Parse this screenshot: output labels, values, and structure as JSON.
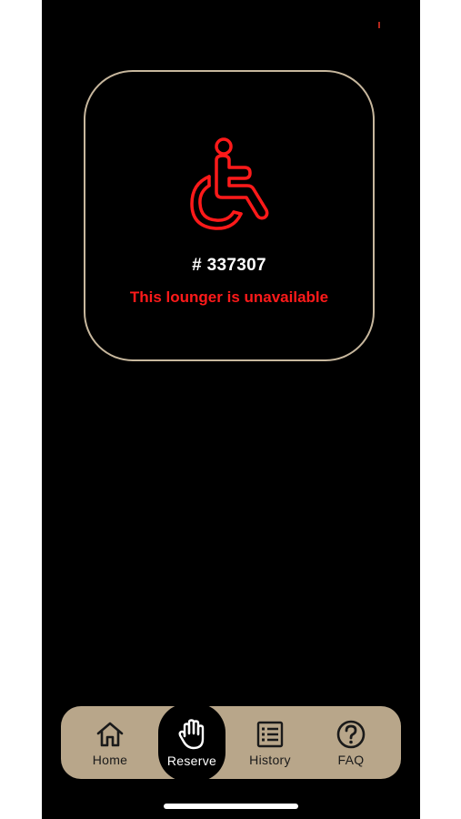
{
  "lounger": {
    "icon": "wheelchair-icon",
    "id_text": "# 337307",
    "status_text": "This lounger is unavailable",
    "status_color": "#ff1a1a"
  },
  "colors": {
    "background": "#000000",
    "card_border": "#c7b79d",
    "tabbar": "#b8a68a",
    "active_tab": "#000000"
  },
  "tabbar": {
    "active": "Reserve",
    "items": [
      {
        "label": "Home",
        "icon": "home-icon"
      },
      {
        "label": "Reserve",
        "icon": "hand-icon"
      },
      {
        "label": "History",
        "icon": "list-icon"
      },
      {
        "label": "FAQ",
        "icon": "question-icon"
      }
    ]
  }
}
